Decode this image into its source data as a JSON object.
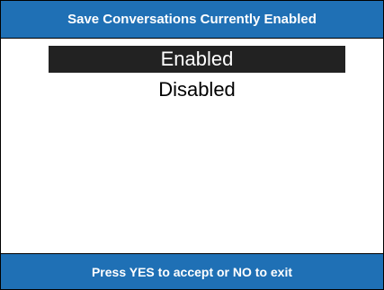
{
  "header": {
    "title": "Save Conversations Currently Enabled"
  },
  "menu": {
    "options": [
      {
        "label": "Enabled",
        "selected": true
      },
      {
        "label": "Disabled",
        "selected": false
      }
    ]
  },
  "footer": {
    "instruction": "Press YES to accept or NO to exit"
  },
  "colors": {
    "header_bar": "#1f70b5",
    "selection_highlight": "#222222",
    "background": "#ffffff"
  }
}
